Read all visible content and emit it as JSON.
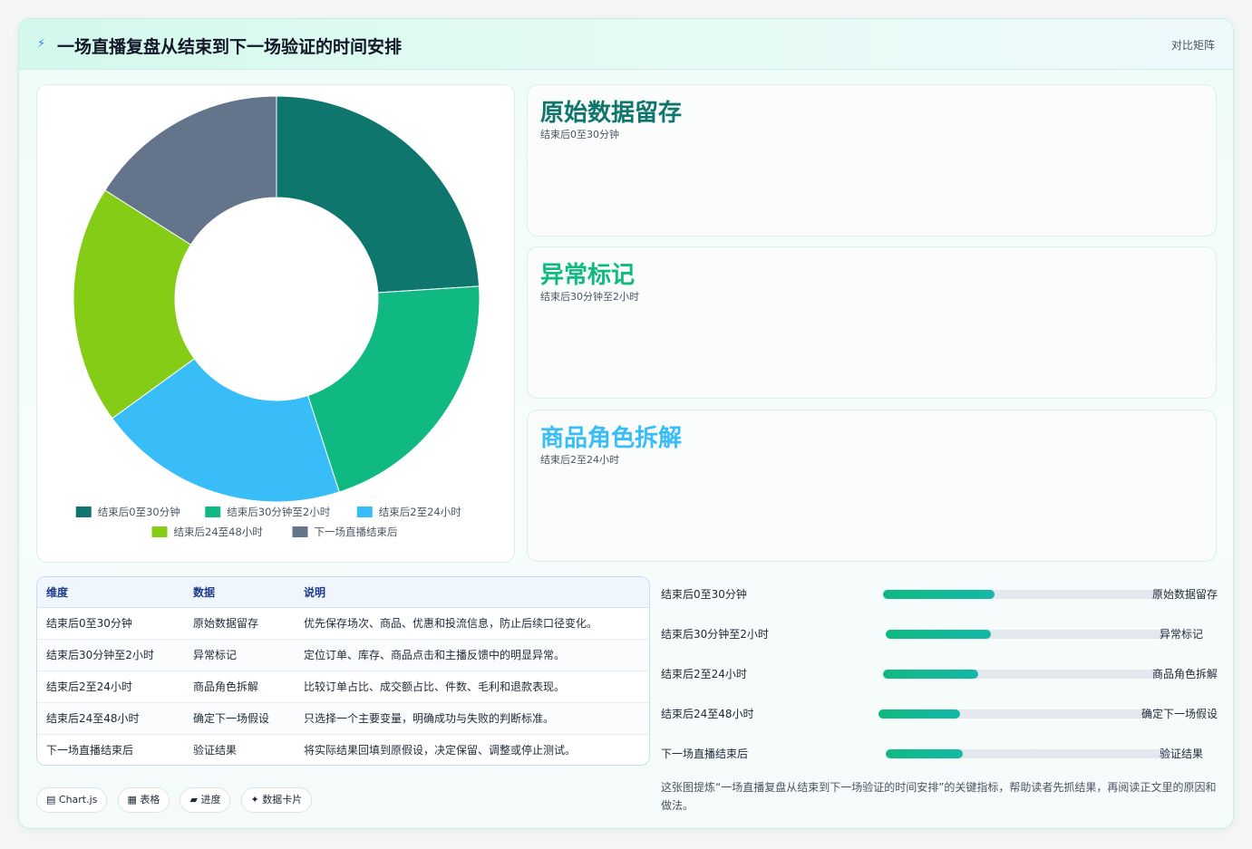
{
  "header": {
    "icon": "bolt-icon",
    "title": "一场直播复盘从结束到下一场验证的时间安排",
    "tag": "对比矩阵"
  },
  "chart_data": {
    "type": "pie",
    "variant": "doughnut",
    "categories": [
      "结束后0至30分钟",
      "结束后30分钟至2小时",
      "结束后2至24小时",
      "结束后24至48小时",
      "下一场直播结束后"
    ],
    "values": [
      24,
      21,
      20,
      19,
      16
    ],
    "colors": [
      "#0f766e",
      "#10b981",
      "#38bdf8",
      "#84cc16",
      "#64748b"
    ],
    "legend_position": "bottom"
  },
  "stats": [
    {
      "title": "原始数据留存",
      "sub": "结束后0至30分钟",
      "color": "#0f766e"
    },
    {
      "title": "异常标记",
      "sub": "结束后30分钟至2小时",
      "color": "#10b981"
    },
    {
      "title": "商品角色拆解",
      "sub": "结束后2至24小时",
      "color": "#38bdf8"
    }
  ],
  "table": {
    "headers": [
      "维度",
      "数据",
      "说明"
    ],
    "rows": [
      [
        "结束后0至30分钟",
        "原始数据留存",
        "优先保存场次、商品、优惠和投流信息，防止后续口径变化。"
      ],
      [
        "结束后30分钟至2小时",
        "异常标记",
        "定位订单、库存、商品点击和主播反馈中的明显异常。"
      ],
      [
        "结束后2至24小时",
        "商品角色拆解",
        "比较订单占比、成交额占比、件数、毛利和退款表现。"
      ],
      [
        "结束后24至48小时",
        "确定下一场假设",
        "只选择一个主要变量，明确成功与失败的判断标准。"
      ],
      [
        "下一场直播结束后",
        "验证结果",
        "将实际结果回填到原假设，决定保留、调整或停止测试。"
      ]
    ]
  },
  "progress": [
    {
      "label": "结束后0至30分钟",
      "right": "原始数据留存",
      "percent": 40
    },
    {
      "label": "结束后30分钟至2小时",
      "right": "异常标记",
      "percent": 37
    },
    {
      "label": "结束后2至24小时",
      "right": "商品角色拆解",
      "percent": 34
    },
    {
      "label": "结束后24至48小时",
      "right": "确定下一场假设",
      "percent": 30
    },
    {
      "label": "下一场直播结束后",
      "right": "验证结果",
      "percent": 27
    }
  ],
  "note": "这张图提炼“一场直播复盘从结束到下一场验证的时间安排”的关键指标，帮助读者先抓结果，再阅读正文里的原因和做法。",
  "chips": [
    "▤ Chart.js",
    "▦ 表格",
    "▰ 进度",
    "✦ 数据卡片"
  ]
}
